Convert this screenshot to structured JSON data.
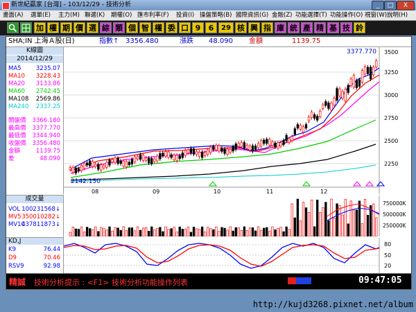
{
  "window": {
    "title": "新世紀贏家 [台灣] - 103/12/29 - 技術分析",
    "buttons": [
      "_",
      "□",
      "X"
    ]
  },
  "menu": [
    "畫面(A)",
    "選單(E)",
    "主力(M)",
    "聯選(K)",
    "期權(O)",
    "匯市利率(F)",
    "投資(I)",
    "操盤策略(B)",
    "國際資訊(G)",
    "金融(Z)",
    "功能選擇(T)",
    "功能操作(O)",
    "視窗(W)",
    "說明(H)"
  ],
  "toolbar": {
    "icons": [
      "search-icon",
      "grid-icon"
    ],
    "buttons": [
      "加",
      "權",
      "期",
      "價",
      "選",
      "綜",
      "類",
      "個",
      "智",
      "權",
      "委",
      "口",
      "9",
      "6",
      "29",
      "核",
      "興",
      "指",
      "庫",
      "統",
      "產",
      "精",
      "基",
      "技",
      "鈴"
    ]
  },
  "header": {
    "symbol": "SHA;IN 上海Ａ股(日)",
    "index_label": "指數↑",
    "index_value": "3356.480",
    "change_label": "漲跌",
    "change_value": "48.090",
    "amount_label": "金額",
    "amount_value": "1139.75"
  },
  "kline": {
    "title": "K線圖",
    "date": "2014/12/29",
    "ma": [
      {
        "label": "MA5",
        "value": "3235.07",
        "color": "#0000ff"
      },
      {
        "label": "MA10",
        "value": "3228.43",
        "color": "#ff0000"
      },
      {
        "label": "MA20",
        "value": "3133.86",
        "color": "#ff00ff"
      },
      {
        "label": "MA60",
        "value": "2742.45",
        "color": "#00cc00"
      },
      {
        "label": "MA108",
        "value": "2569.86",
        "color": "#000000"
      },
      {
        "label": "MA240",
        "value": "2337.25",
        "color": "#00cccc"
      }
    ],
    "prices": [
      {
        "label": "開盤價",
        "value": "3366.180"
      },
      {
        "label": "最高價",
        "value": "3377.770"
      },
      {
        "label": "最低價",
        "value": "3344.940"
      },
      {
        "label": "收盤價",
        "value": "3356.480"
      },
      {
        "label": "金額",
        "value": "1139.75"
      },
      {
        "label": "差",
        "value": "48.090"
      }
    ],
    "max_label": "3377.770",
    "min_label": "2142.150",
    "y_ticks": [
      "3500",
      "3250",
      "3000",
      "2750",
      "2500",
      "2250"
    ],
    "x_labels": [
      "08",
      "09",
      "10",
      "11",
      "12"
    ]
  },
  "volume": {
    "title": "成交量",
    "rows": [
      {
        "label": "VOL",
        "value": "100231568↓",
        "color": "#0000ff"
      },
      {
        "label": "MV5",
        "value": "350010282↓",
        "color": "#ff0000"
      },
      {
        "label": "MV10",
        "value": "437811873↓",
        "color": "#0000ff"
      }
    ],
    "y_ticks": [
      "750000K",
      "500000K",
      "250000K"
    ]
  },
  "kdj": {
    "title": "KD,J",
    "rows": [
      {
        "label": "K9",
        "value": "76.44",
        "color": "#0000ff"
      },
      {
        "label": "D9",
        "value": "70.46",
        "color": "#ff0000"
      },
      {
        "label": "RSV9",
        "value": "92.98",
        "color": "#0000ff"
      }
    ],
    "y_ticks": [
      "80",
      "50",
      "20"
    ]
  },
  "status": {
    "label": "精誠",
    "hint": "技術分析提示 : <F1> 技術分析功能操作列表",
    "time": "09:47:05"
  },
  "watermark": "http://kujd3268.pixnet.net/album"
}
